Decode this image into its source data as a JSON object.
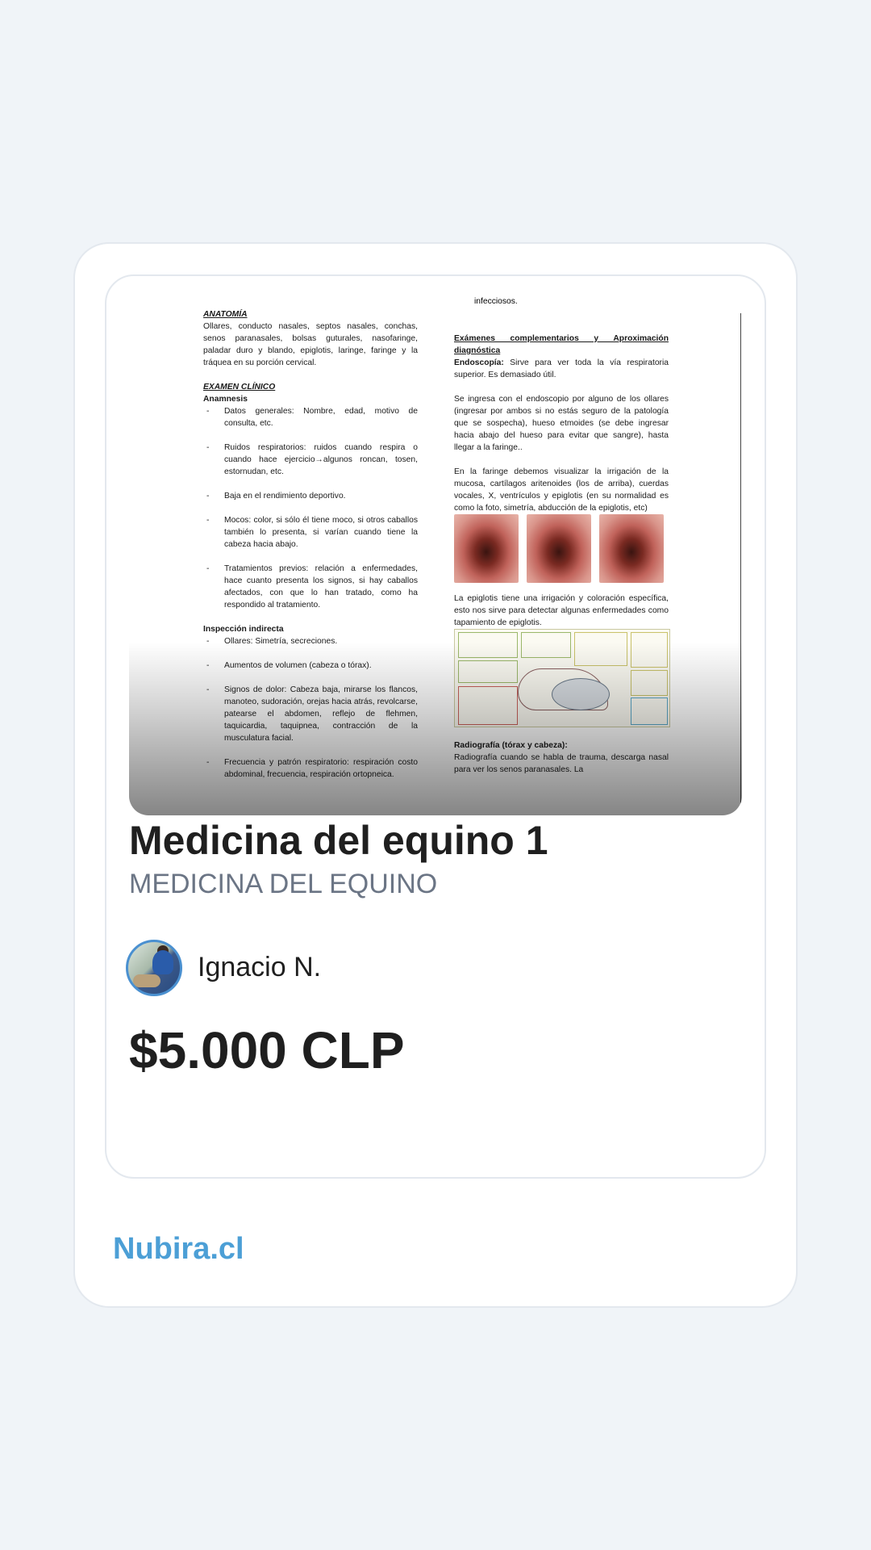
{
  "listing": {
    "title": "Medicina del equino 1",
    "course": "MEDICINA DEL EQUINO",
    "author": "Ignacio N.",
    "price": "$5.000 CLP"
  },
  "footer": {
    "brand": "Nubira.cl"
  },
  "preview": {
    "top_line": "infecciosos.",
    "left": {
      "anatomy_heading": "ANATOMÍA",
      "anatomy_text": "Ollares, conducto nasales, septos nasales, conchas, senos paranasales, bolsas guturales, nasofaringe, paladar duro y blando, epiglotis, laringe, faringe y la tráquea en su porción cervical.",
      "clinical_heading": "EXAMEN CLÍNICO",
      "anamnesis_heading": "Anamnesis",
      "anamnesis_items": [
        "Datos generales: Nombre, edad, motivo de consulta, etc.",
        "Ruidos respiratorios: ruidos cuando respira o cuando hace ejercicio→algunos roncan, tosen, estornudan, etc.",
        "Baja en el rendimiento deportivo.",
        "Mocos: color, si sólo él tiene moco, si otros caballos también lo presenta, si varían cuando tiene la cabeza hacia abajo.",
        "Tratamientos previos: relación a enfermedades, hace cuanto presenta los signos, si hay caballos afectados, con que lo han tratado, como ha respondido al tratamiento."
      ],
      "indirect_heading": "Inspección indirecta",
      "indirect_items": [
        "Ollares: Simetría, secreciones.",
        "Aumentos de volumen (cabeza o tórax).",
        "Signos de dolor: Cabeza baja, mirarse los flancos, manoteo, sudoración, orejas hacia atrás, revolcarse, patearse el abdomen, reflejo de flehmen, taquicardia, taquipnea, contracción de la musculatura facial.",
        "Frecuencia y patrón respiratorio: respiración costo abdominal, frecuencia, respiración ortopneica."
      ]
    },
    "right": {
      "exams_heading": "Exámenes complementarios y Aproximación diagnóstica",
      "endoscopy_label": "Endoscopía:",
      "endoscopy_text": " Sirve para ver toda la vía respiratoria superior. Es demasiado útil.",
      "para2": "Se ingresa con el endoscopio por alguno de los ollares (ingresar por ambos si no estás seguro de la patología que se sospecha), hueso etmoides (se debe ingresar hacia abajo del hueso para evitar que sangre), hasta llegar a la faringe..",
      "para3": "En la faringe debemos visualizar la irrigación de la mucosa, cartílagos aritenoides (los de arriba), cuerdas vocales, X, ventrículos y epiglotis (en su normalidad es como la foto, simetría, abducción de la epiglotis, etc)",
      "para4": "La epiglotis tiene una irrigación y coloración específica, esto nos sirve para detectar algunas enfermedades como tapamiento de epiglotis.",
      "radiography_heading": "Radiografía (tórax y cabeza):",
      "radiography_text": "Radiografía cuando se habla de trauma, descarga nasal para ver los senos paranasales. La"
    }
  }
}
